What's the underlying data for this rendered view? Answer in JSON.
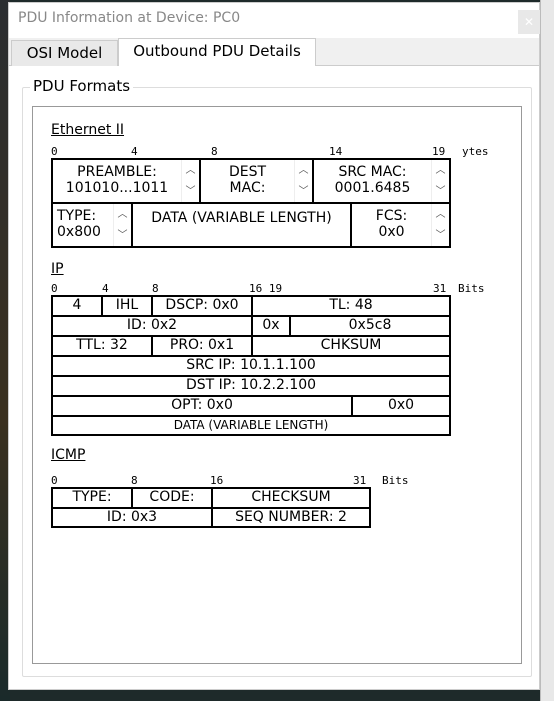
{
  "window": {
    "title": "PDU Information at Device: PC0",
    "close_icon": "close-icon"
  },
  "tabs": [
    {
      "label": "OSI Model",
      "selected": false
    },
    {
      "label": "Outbound PDU Details",
      "selected": true
    }
  ],
  "group": {
    "label": "PDU Formats"
  },
  "ethernet": {
    "title": "Ethernet II",
    "ruler": [
      "0",
      "4",
      "8",
      "14",
      "19"
    ],
    "ruler_unit": "ytes",
    "preamble": {
      "label": "PREAMBLE:",
      "value": "101010...1011"
    },
    "dest_mac": {
      "label": "DEST",
      "value": "MAC:"
    },
    "src_mac": {
      "label": "SRC MAC:",
      "value": "0001.6485"
    },
    "type": {
      "label": "TYPE:",
      "value": "0x800"
    },
    "data": "DATA (VARIABLE LENGTH)",
    "fcs": {
      "label": "FCS:",
      "value": "0x0"
    }
  },
  "ip": {
    "title": "IP",
    "ruler": [
      "0",
      "4",
      "8",
      "16 19",
      "31"
    ],
    "ruler_unit": "Bits",
    "version": "4",
    "ihl": "IHL",
    "dscp": "DSCP: 0x0",
    "tl": "TL: 48",
    "id": "ID: 0x2",
    "flags": "0x",
    "frag": "0x5c8",
    "ttl": "TTL: 32",
    "pro": "PRO: 0x1",
    "chksum": "CHKSUM",
    "src": "SRC IP: 10.1.1.100",
    "dst": "DST IP: 10.2.2.100",
    "opt": "OPT: 0x0",
    "pad": "0x0",
    "data": "DATA (VARIABLE LENGTH)"
  },
  "icmp": {
    "title": "ICMP",
    "ruler": [
      "0",
      "8",
      "16",
      "31"
    ],
    "ruler_unit": "Bits",
    "type": "TYPE:",
    "code": "CODE:",
    "checksum": "CHECKSUM",
    "id": "ID: 0x3",
    "seq": "SEQ NUMBER: 2"
  }
}
